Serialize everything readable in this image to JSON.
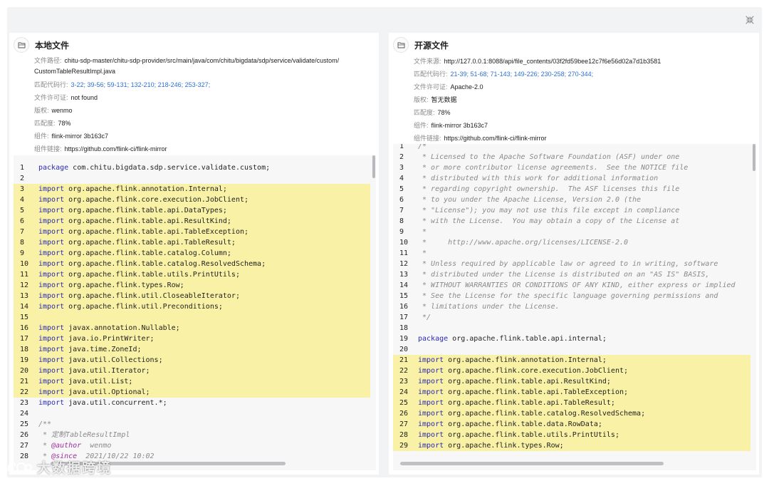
{
  "left": {
    "title": "本地文件",
    "meta": {
      "path_label": "文件路径:",
      "path_line1": "chitu-sdp-master/chitu-sdp-provider/src/main/java/com/chitu/bigdata/sdp/service/validate/custom/",
      "path_line2": "CustomTableResultImpl.java",
      "lines_label": "匹配代码行:",
      "lines_value": "3-22; 39-56; 59-131; 132-210; 218-246; 253-327;",
      "license_label": "文件许可证:",
      "license_value": "not found",
      "copyright_label": "版权:",
      "copyright_value": "wenmo",
      "match_label": "匹配度:",
      "match_value": "78%",
      "component_label": "组件:",
      "component_value": "flink-mirror 3b163c7",
      "link_label": "组件链接:",
      "link_value": "https://github.com/flink-ci/flink-mirror"
    },
    "code": [
      {
        "n": "1",
        "t": "package com.chitu.bigdata.sdp.service.validate.custom;",
        "s": "kw-first",
        "hl": false
      },
      {
        "n": "2",
        "t": "",
        "s": "plain",
        "hl": false
      },
      {
        "n": "3",
        "t": "import org.apache.flink.annotation.Internal;",
        "s": "kw-first",
        "hl": true
      },
      {
        "n": "4",
        "t": "import org.apache.flink.core.execution.JobClient;",
        "s": "kw-first",
        "hl": true
      },
      {
        "n": "5",
        "t": "import org.apache.flink.table.api.DataTypes;",
        "s": "kw-first",
        "hl": true
      },
      {
        "n": "6",
        "t": "import org.apache.flink.table.api.ResultKind;",
        "s": "kw-first",
        "hl": true
      },
      {
        "n": "7",
        "t": "import org.apache.flink.table.api.TableException;",
        "s": "kw-first",
        "hl": true
      },
      {
        "n": "8",
        "t": "import org.apache.flink.table.api.TableResult;",
        "s": "kw-first",
        "hl": true
      },
      {
        "n": "9",
        "t": "import org.apache.flink.table.catalog.Column;",
        "s": "kw-first",
        "hl": true
      },
      {
        "n": "10",
        "t": "import org.apache.flink.table.catalog.ResolvedSchema;",
        "s": "kw-first",
        "hl": true
      },
      {
        "n": "11",
        "t": "import org.apache.flink.table.utils.PrintUtils;",
        "s": "kw-first",
        "hl": true
      },
      {
        "n": "12",
        "t": "import org.apache.flink.types.Row;",
        "s": "kw-first",
        "hl": true
      },
      {
        "n": "13",
        "t": "import org.apache.flink.util.CloseableIterator;",
        "s": "kw-first",
        "hl": true
      },
      {
        "n": "14",
        "t": "import org.apache.flink.util.Preconditions;",
        "s": "kw-first",
        "hl": true
      },
      {
        "n": "15",
        "t": "",
        "s": "plain",
        "hl": true
      },
      {
        "n": "16",
        "t": "import javax.annotation.Nullable;",
        "s": "kw-first",
        "hl": true
      },
      {
        "n": "17",
        "t": "import java.io.PrintWriter;",
        "s": "kw-first",
        "hl": true
      },
      {
        "n": "18",
        "t": "import java.time.ZoneId;",
        "s": "kw-first",
        "hl": true
      },
      {
        "n": "19",
        "t": "import java.util.Collections;",
        "s": "kw-first",
        "hl": true
      },
      {
        "n": "20",
        "t": "import java.util.Iterator;",
        "s": "kw-first",
        "hl": true
      },
      {
        "n": "21",
        "t": "import java.util.List;",
        "s": "kw-first",
        "hl": true
      },
      {
        "n": "22",
        "t": "import java.util.Optional;",
        "s": "kw-first",
        "hl": true
      },
      {
        "n": "23",
        "t": "import java.util.concurrent.*;",
        "s": "kw-first",
        "hl": false
      },
      {
        "n": "24",
        "t": "",
        "s": "plain",
        "hl": false
      },
      {
        "n": "25",
        "t": "/**",
        "s": "comment",
        "hl": false
      },
      {
        "n": "26",
        "t": " * 定制TableResultImpl",
        "s": "comment",
        "hl": false
      },
      {
        "n": "27",
        "t": " * @author  wenmo",
        "s": "comment-tag",
        "hl": false
      },
      {
        "n": "28",
        "t": " * @since  2021/10/22 10:02",
        "s": "comment-tag",
        "hl": false
      }
    ]
  },
  "right": {
    "title": "开源文件",
    "meta": {
      "source_label": "文件来源:",
      "source_value": "http://127.0.0.1:8088/api/file_contents/03f2fd59bee12c7f6e56d02a7d1b3581",
      "lines_label": "匹配代码行:",
      "lines_value": "21-39; 51-68; 71-143; 149-226; 230-258; 270-344;",
      "license_label": "文件许可证:",
      "license_value": "Apache-2.0",
      "copyright_label": "版权:",
      "copyright_value": "暂无数据",
      "match_label": "匹配度:",
      "match_value": "78%",
      "component_label": "组件:",
      "component_value": "flink-mirror 3b163c7",
      "link_label": "组件链接:",
      "link_value": "https://github.com/flink-ci/flink-mirror"
    },
    "code": [
      {
        "n": "1",
        "t": "/*",
        "s": "comment",
        "hl": false
      },
      {
        "n": "2",
        "t": " * Licensed to the Apache Software Foundation (ASF) under one",
        "s": "comment",
        "hl": false
      },
      {
        "n": "3",
        "t": " * or more contributor license agreements.  See the NOTICE file",
        "s": "comment",
        "hl": false
      },
      {
        "n": "4",
        "t": " * distributed with this work for additional information",
        "s": "comment",
        "hl": false
      },
      {
        "n": "5",
        "t": " * regarding copyright ownership.  The ASF licenses this file",
        "s": "comment",
        "hl": false
      },
      {
        "n": "6",
        "t": " * to you under the Apache License, Version 2.0 (the",
        "s": "comment",
        "hl": false
      },
      {
        "n": "7",
        "t": " * \"License\"); you may not use this file except in compliance",
        "s": "comment",
        "hl": false
      },
      {
        "n": "8",
        "t": " * with the License.  You may obtain a copy of the License at",
        "s": "comment",
        "hl": false
      },
      {
        "n": "9",
        "t": " *",
        "s": "comment",
        "hl": false
      },
      {
        "n": "10",
        "t": " *     http://www.apache.org/licenses/LICENSE-2.0",
        "s": "comment",
        "hl": false
      },
      {
        "n": "11",
        "t": " *",
        "s": "comment",
        "hl": false
      },
      {
        "n": "12",
        "t": " * Unless required by applicable law or agreed to in writing, software",
        "s": "comment",
        "hl": false
      },
      {
        "n": "13",
        "t": " * distributed under the License is distributed on an \"AS IS\" BASIS,",
        "s": "comment",
        "hl": false
      },
      {
        "n": "14",
        "t": " * WITHOUT WARRANTIES OR CONDITIONS OF ANY KIND, either express or implied",
        "s": "comment",
        "hl": false
      },
      {
        "n": "15",
        "t": " * See the License for the specific language governing permissions and",
        "s": "comment",
        "hl": false
      },
      {
        "n": "16",
        "t": " * limitations under the License.",
        "s": "comment",
        "hl": false
      },
      {
        "n": "17",
        "t": " */",
        "s": "comment",
        "hl": false
      },
      {
        "n": "18",
        "t": "",
        "s": "plain",
        "hl": false
      },
      {
        "n": "19",
        "t": "package org.apache.flink.table.api.internal;",
        "s": "kw-first",
        "hl": false
      },
      {
        "n": "20",
        "t": "",
        "s": "plain",
        "hl": false
      },
      {
        "n": "21",
        "t": "import org.apache.flink.annotation.Internal;",
        "s": "kw-first",
        "hl": true
      },
      {
        "n": "22",
        "t": "import org.apache.flink.core.execution.JobClient;",
        "s": "kw-first",
        "hl": true
      },
      {
        "n": "23",
        "t": "import org.apache.flink.table.api.ResultKind;",
        "s": "kw-first",
        "hl": true
      },
      {
        "n": "24",
        "t": "import org.apache.flink.table.api.TableException;",
        "s": "kw-first",
        "hl": true
      },
      {
        "n": "25",
        "t": "import org.apache.flink.table.api.TableResult;",
        "s": "kw-first",
        "hl": true
      },
      {
        "n": "26",
        "t": "import org.apache.flink.table.catalog.ResolvedSchema;",
        "s": "kw-first",
        "hl": true
      },
      {
        "n": "27",
        "t": "import org.apache.flink.table.data.RowData;",
        "s": "kw-first",
        "hl": true
      },
      {
        "n": "28",
        "t": "import org.apache.flink.table.utils.PrintUtils;",
        "s": "kw-first",
        "hl": true
      },
      {
        "n": "29",
        "t": "import org.apache.flink.types.Row;",
        "s": "kw-first",
        "hl": true
      }
    ]
  },
  "watermark": "大数据跨境",
  "colors": {
    "highlight": "#f8f1a6",
    "keyword": "#2a2ab0",
    "comment": "#8a8a8a",
    "link_blue": "#2f6fd6",
    "annotation": "#9d2f9d"
  },
  "icons": {
    "close": "collapse-arrows-icon",
    "panel": "folder-icon"
  }
}
